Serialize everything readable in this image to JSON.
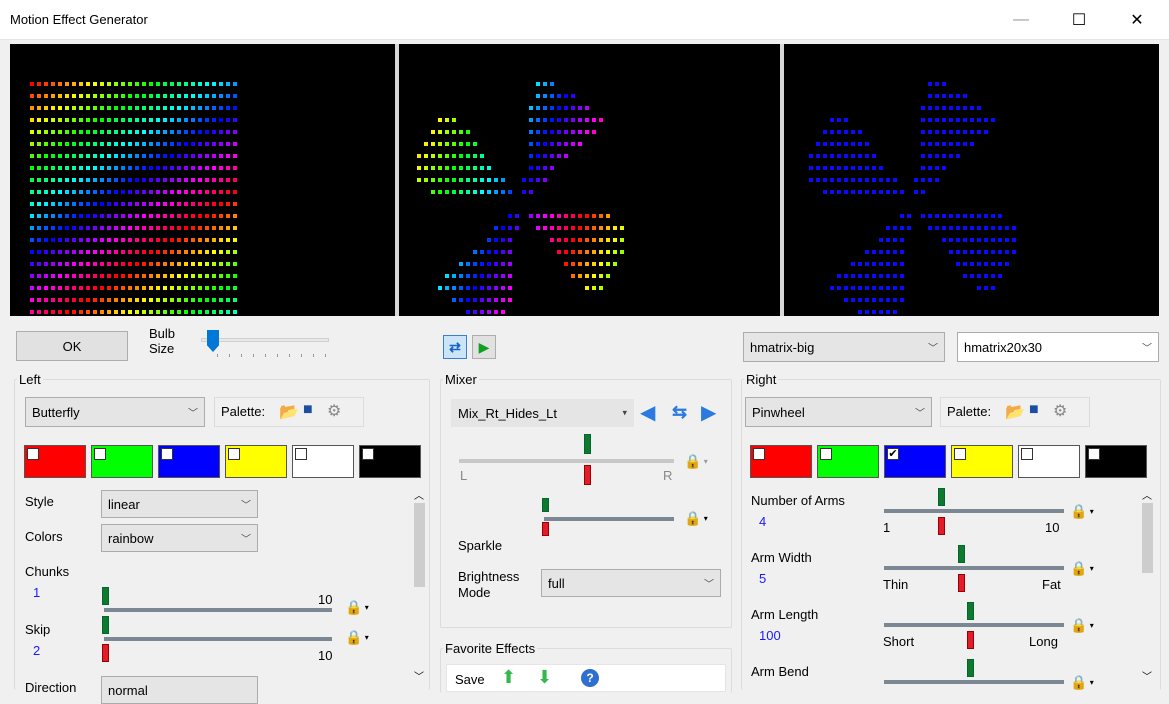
{
  "window": {
    "title": "Motion Effect Generator",
    "minimize": "—",
    "maximize": "☐",
    "close": "✕"
  },
  "toolbar": {
    "ok_label": "OK",
    "bulb_size_label": "Bulb\nSize",
    "bulb_size_value": 0.08,
    "model_select": "hmatrix-big",
    "submodel_select": "hmatrix20x30"
  },
  "left": {
    "legend": "Left",
    "effect": "Butterfly",
    "palette_label": "Palette:",
    "swatches": [
      {
        "color": "#ff0000",
        "checked": false
      },
      {
        "color": "#00ff00",
        "checked": false
      },
      {
        "color": "#0000ff",
        "checked": false
      },
      {
        "color": "#ffff00",
        "checked": false
      },
      {
        "color": "#ffffff",
        "checked": false
      },
      {
        "color": "#000000",
        "checked": false
      }
    ],
    "style_label": "Style",
    "style_value": "linear",
    "colors_label": "Colors",
    "colors_value": "rainbow",
    "chunks_label": "Chunks",
    "chunks_value": "1",
    "chunks_max": "10",
    "skip_label": "Skip",
    "skip_value": "2",
    "skip_max": "10",
    "direction_label": "Direction",
    "direction_value": "normal"
  },
  "mixer": {
    "legend": "Mixer",
    "mode": "Mix_Rt_Hides_Lt",
    "l_label": "L",
    "r_label": "R",
    "sparkle_label": "Sparkle",
    "brightness_label": "Brightness\nMode",
    "brightness_value": "full"
  },
  "favorites": {
    "legend": "Favorite Effects",
    "save_label": "Save"
  },
  "right": {
    "legend": "Right",
    "effect": "Pinwheel",
    "palette_label": "Palette:",
    "swatches": [
      {
        "color": "#ff0000",
        "checked": false
      },
      {
        "color": "#00ff00",
        "checked": false
      },
      {
        "color": "#0000ff",
        "checked": true
      },
      {
        "color": "#ffff00",
        "checked": false
      },
      {
        "color": "#ffffff",
        "checked": false
      },
      {
        "color": "#000000",
        "checked": false
      }
    ],
    "arms_label": "Number of Arms",
    "arms_value": "4",
    "arms_min": "1",
    "arms_max": "10",
    "width_label": "Arm Width",
    "width_value": "5",
    "width_min": "Thin",
    "width_max": "Fat",
    "length_label": "Arm Length",
    "length_value": "100",
    "length_min": "Short",
    "length_max": "Long",
    "bend_label": "Arm Bend"
  },
  "icons": {
    "lock": "lock-icon",
    "play": "play-icon",
    "loop": "loop-icon",
    "open": "folder-open-icon",
    "save": "save-icon",
    "gear": "gear-icon",
    "up": "up-arrow-icon",
    "down": "down-arrow-icon",
    "help": "help-icon"
  }
}
